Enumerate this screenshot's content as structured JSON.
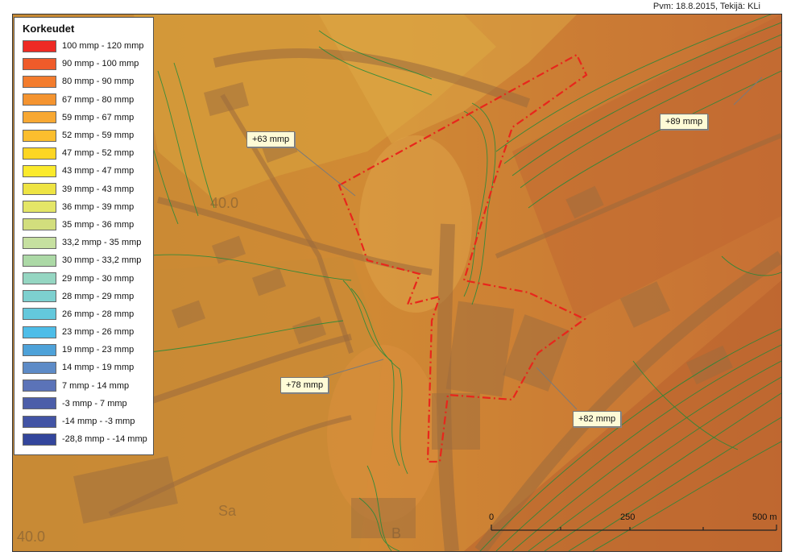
{
  "credit": "Pvm: 18.8.2015, Tekijä: KLi",
  "legend": {
    "title": "Korkeudet",
    "items": [
      {
        "label": "100 mmp - 120 mmp",
        "color": "#ee2a24"
      },
      {
        "label": "90 mmp - 100 mmp",
        "color": "#ef5b2a"
      },
      {
        "label": "80 mmp - 90 mmp",
        "color": "#f37c2d"
      },
      {
        "label": "67 mmp - 80 mmp",
        "color": "#f49430"
      },
      {
        "label": "59 mmp - 67 mmp",
        "color": "#f7a833"
      },
      {
        "label": "52 mmp - 59 mmp",
        "color": "#fbbe2e"
      },
      {
        "label": "47 mmp - 52 mmp",
        "color": "#fdd623"
      },
      {
        "label": "43 mmp - 47 mmp",
        "color": "#fbea2c"
      },
      {
        "label": "39 mmp - 43 mmp",
        "color": "#eee443"
      },
      {
        "label": "36 mmp - 39 mmp",
        "color": "#e4e667"
      },
      {
        "label": "35 mmp - 36 mmp",
        "color": "#d2de7d"
      },
      {
        "label": "33,2 mmp - 35 mmp",
        "color": "#c6e0a0"
      },
      {
        "label": "30 mmp - 33,2 mmp",
        "color": "#acd9a6"
      },
      {
        "label": "29 mmp - 30 mmp",
        "color": "#95d6c2"
      },
      {
        "label": "28 mmp - 29 mmp",
        "color": "#7dd0cf"
      },
      {
        "label": "26 mmp - 28 mmp",
        "color": "#63c8dc"
      },
      {
        "label": "23 mmp - 26 mmp",
        "color": "#4dbde8"
      },
      {
        "label": "19 mmp - 23 mmp",
        "color": "#4ea2d9"
      },
      {
        "label": "14 mmp - 19 mmp",
        "color": "#5d8bc7"
      },
      {
        "label": "7 mmp - 14 mmp",
        "color": "#5b73b8"
      },
      {
        "label": "-3 mmp - 7 mmp",
        "color": "#4c5ea9"
      },
      {
        "label": "-14 mmp - -3 mmp",
        "color": "#4254a5"
      },
      {
        "label": "-28,8 mmp - -14 mmp",
        "color": "#33469c"
      }
    ]
  },
  "callouts": [
    {
      "id": "c63",
      "label": "+63 mmp"
    },
    {
      "id": "c89",
      "label": "+89 mmp"
    },
    {
      "id": "c78",
      "label": "+78 mmp"
    },
    {
      "id": "c82",
      "label": "+82 mmp"
    }
  ],
  "map_labels": {
    "grid_a": "40.0",
    "grid_b": "40.0",
    "place_a": "Sa",
    "place_b": "B"
  },
  "scalebar": {
    "ticks": [
      {
        "label": "0",
        "value": 0
      },
      {
        "label": "250",
        "value": 250
      },
      {
        "label": "500 m",
        "value": 500
      }
    ]
  }
}
